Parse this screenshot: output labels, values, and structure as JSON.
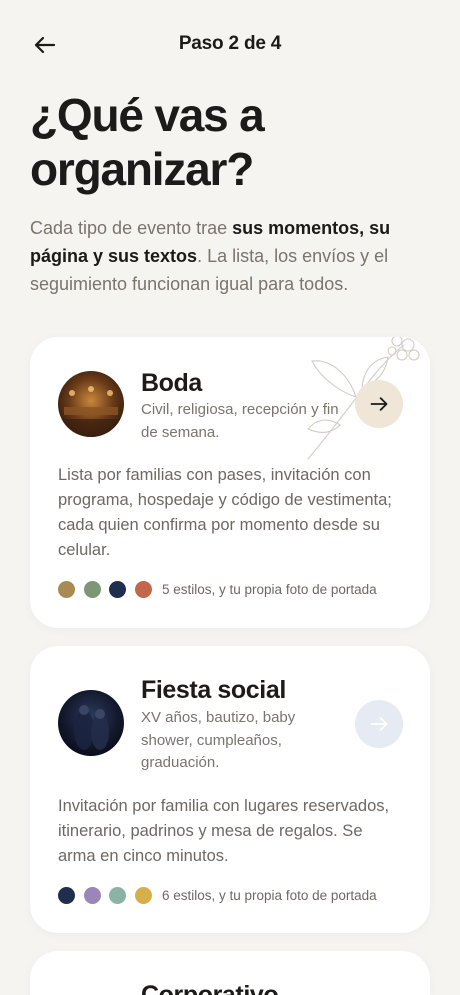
{
  "header": {
    "step": "Paso 2 de 4",
    "back_icon": "arrow-left-icon"
  },
  "title": "¿Qué vas a organizar?",
  "intro": {
    "pre": "Cada tipo de evento trae ",
    "bold": "sus momentos, su página y sus textos",
    "post": ". La lista, los envíos y el seguimiento funcionan igual para todos."
  },
  "cards": [
    {
      "title": "Boda",
      "subtitle": "Civil, religiosa, recepción y fin de semana.",
      "description": "Lista por familias con pases, invitación con programa, hospedaje y código de vestimenta; cada quien confirma por momento desde su celular.",
      "styles_text": "5 estilos, y tu propia foto de portada",
      "swatches": [
        "#a88a52",
        "#7d9676",
        "#1f2d4f",
        "#c0674c"
      ],
      "selected": true,
      "arrow_icon": "arrow-right-icon",
      "decoration_icon": "flower-branch-icon"
    },
    {
      "title": "Fiesta social",
      "subtitle": "XV años, bautizo, baby shower, cumpleaños, graduación.",
      "description": "Invitación por familia con lugares reservados, itinerario, padrinos y mesa de regalos. Se arma en cinco minutos.",
      "styles_text": "6 estilos, y tu propia foto de portada",
      "swatches": [
        "#1f2d4f",
        "#9a86b8",
        "#8ab3a6",
        "#d6ae4a"
      ],
      "selected": false,
      "arrow_icon": "arrow-right-icon"
    },
    {
      "title": "Corporativo"
    }
  ],
  "colors": {
    "background": "#f6f4f0",
    "card": "#ffffff",
    "selected_button": "#efe6d8",
    "unselected_button": "#e6eaf2"
  }
}
